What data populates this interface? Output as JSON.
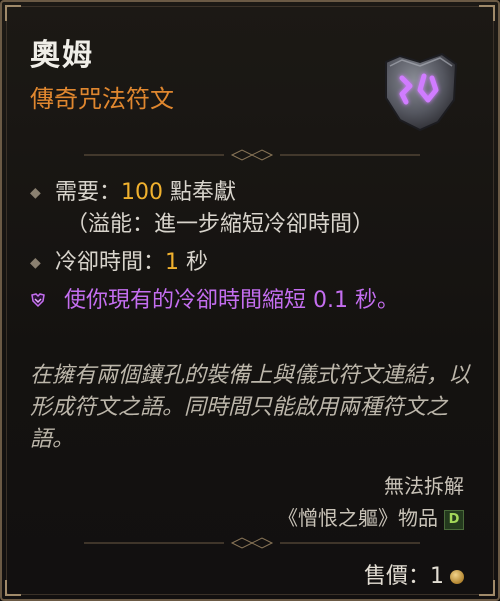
{
  "item": {
    "name": "奧姆",
    "type": "傳奇咒法符文"
  },
  "requirements": {
    "label": "需要：",
    "value": "100",
    "unit": " 點奉獻",
    "note": "（溢能：進一步縮短冷卻時間）"
  },
  "cooldown": {
    "label": "冷卻時間：",
    "value": "1",
    "unit": " 秒"
  },
  "aspect": {
    "text": "使你現有的冷卻時間縮短 0.1 秒。"
  },
  "flavor": {
    "text": "在擁有兩個鑲孔的裝備上與儀式符文連結，以形成符文之語。同時間只能啟用兩種符文之語。"
  },
  "footer": {
    "salvage": "無法拆解",
    "source": "《憎恨之軀》物品",
    "source_badge": "D",
    "price_label": "售價：",
    "price_value": "1"
  },
  "colors": {
    "legendary": "#e0872f",
    "value": "#f0b12e",
    "aspect": "#c46ef0",
    "text": "#d8d4cc"
  },
  "icons": {
    "rune": "purple-rune-stone-icon",
    "currency": "gold-coin-icon"
  }
}
